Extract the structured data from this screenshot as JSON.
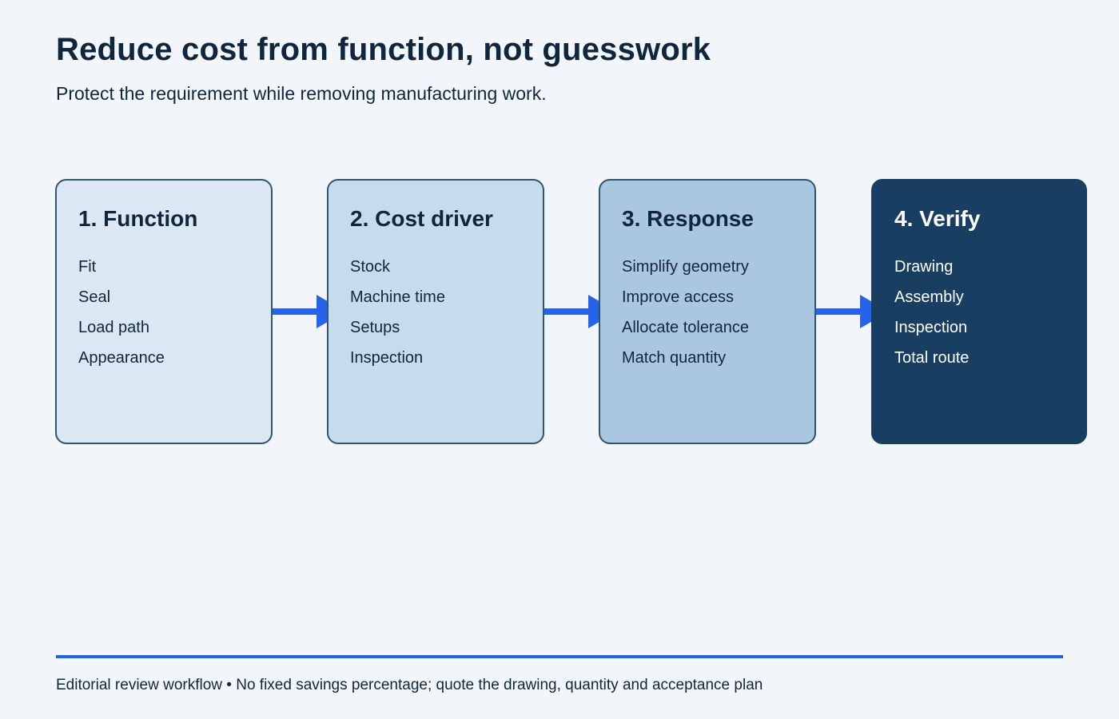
{
  "header": {
    "title": "Reduce cost from function, not guesswork",
    "subtitle": "Protect the requirement while removing manufacturing work."
  },
  "steps": [
    {
      "title": "1. Function",
      "items": [
        "Fit",
        "Seal",
        "Load path",
        "Appearance"
      ]
    },
    {
      "title": "2. Cost driver",
      "items": [
        "Stock",
        "Machine time",
        "Setups",
        "Inspection"
      ]
    },
    {
      "title": "3. Response",
      "items": [
        "Simplify geometry",
        "Improve access",
        "Allocate tolerance",
        "Match quantity"
      ]
    },
    {
      "title": "4. Verify",
      "items": [
        "Drawing",
        "Assembly",
        "Inspection",
        "Total route"
      ]
    }
  ],
  "footer": {
    "note": "Editorial review workflow • No fixed savings percentage; quote the drawing, quantity and acceptance plan"
  },
  "colors": {
    "background": "#f2f6fb",
    "text": "#10263d",
    "arrow": "#2563eb",
    "step_1": "#dbe8f3",
    "step_2": "#c6dbeb",
    "step_3": "#a9c7de",
    "step_4": "#183f61",
    "border": "#2f5570"
  }
}
